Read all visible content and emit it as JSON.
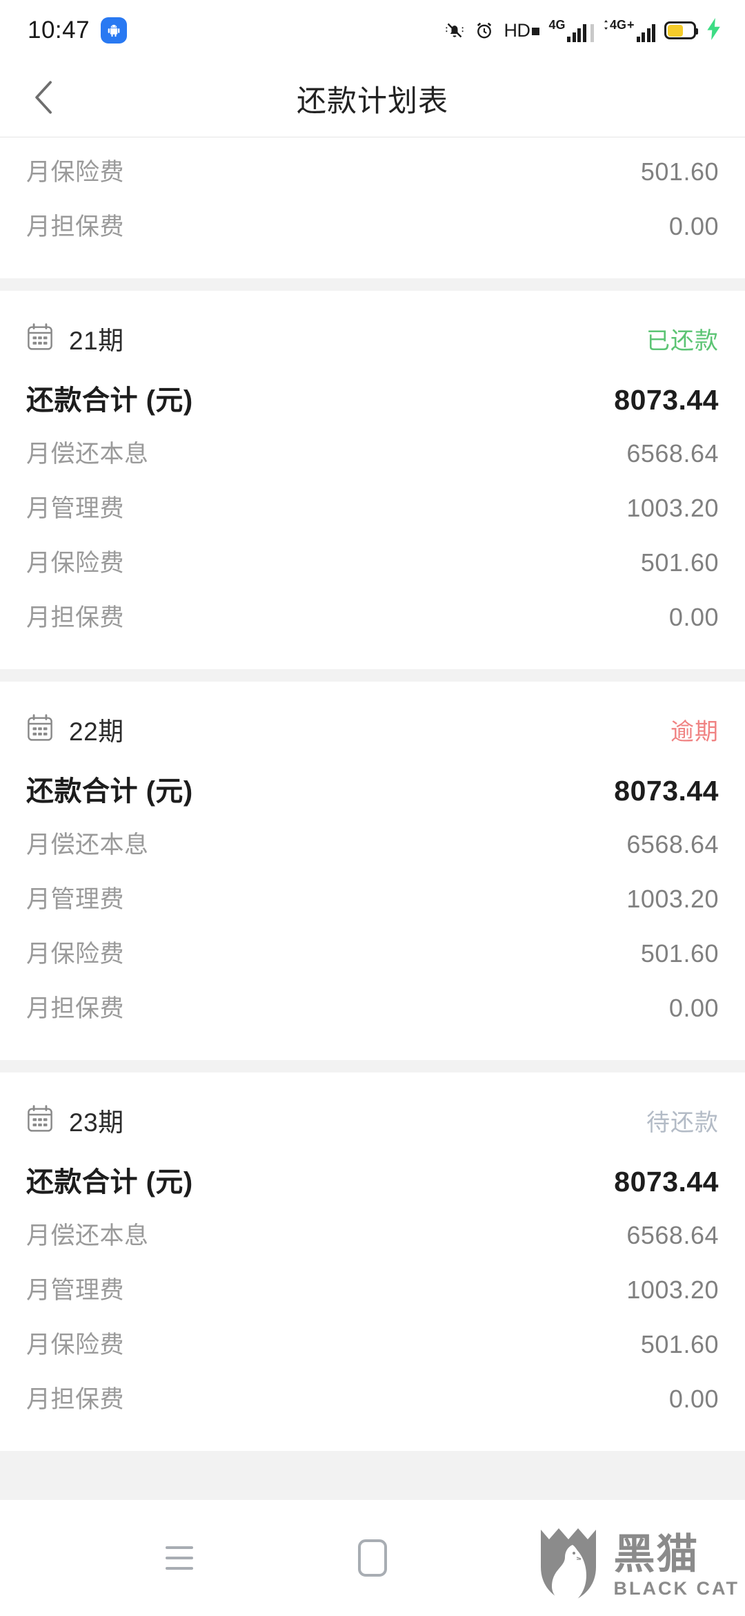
{
  "status_bar": {
    "time": "10:47",
    "app_badge_icon": "android-robot-icon",
    "icons": [
      "mute-vibrate-icon",
      "alarm-clock-icon",
      "hd-voice-icon",
      "signal-4g-icon",
      "signal-4g-plus-icon",
      "battery-charging-icon"
    ],
    "hd_label": "HD",
    "sim1_label": "4G",
    "sim2_label": "4G",
    "colors": {
      "android_badge": "#2979f2",
      "battery_fill": "#f5cc2a",
      "charging_bolt": "#3ddc84"
    }
  },
  "header": {
    "back_icon": "chevron-left-icon",
    "title": "还款计划表"
  },
  "colors": {
    "paid": "#5cc474",
    "overdue": "#f08383",
    "pending": "#b3bbc6",
    "page_bg": "#f2f2f2",
    "card_bg": "#ffffff"
  },
  "labels": {
    "total": "还款合计 (元)",
    "principal_interest": "月偿还本息",
    "management_fee": "月管理费",
    "insurance_fee": "月保险费",
    "guarantee_fee": "月担保费",
    "calendar_icon": "calendar-icon"
  },
  "installments": [
    {
      "partial": true,
      "period": "",
      "status": "",
      "status_type": "",
      "total": "",
      "rows": [
        {
          "label": "月保险费",
          "value": "501.60"
        },
        {
          "label": "月担保费",
          "value": "0.00"
        }
      ]
    },
    {
      "partial": false,
      "period": "21期",
      "status": "已还款",
      "status_type": "paid",
      "total_label": "还款合计 (元)",
      "total": "8073.44",
      "rows": [
        {
          "label": "月偿还本息",
          "value": "6568.64"
        },
        {
          "label": "月管理费",
          "value": "1003.20"
        },
        {
          "label": "月保险费",
          "value": "501.60"
        },
        {
          "label": "月担保费",
          "value": "0.00"
        }
      ]
    },
    {
      "partial": false,
      "period": "22期",
      "status": "逾期",
      "status_type": "overdue",
      "total_label": "还款合计 (元)",
      "total": "8073.44",
      "rows": [
        {
          "label": "月偿还本息",
          "value": "6568.64"
        },
        {
          "label": "月管理费",
          "value": "1003.20"
        },
        {
          "label": "月保险费",
          "value": "501.60"
        },
        {
          "label": "月担保费",
          "value": "0.00"
        }
      ]
    },
    {
      "partial": false,
      "period": "23期",
      "status": "待还款",
      "status_type": "pending",
      "total_label": "还款合计 (元)",
      "total": "8073.44",
      "rows": [
        {
          "label": "月偿还本息",
          "value": "6568.64"
        },
        {
          "label": "月管理费",
          "value": "1003.20"
        },
        {
          "label": "月保险费",
          "value": "501.60"
        },
        {
          "label": "月担保费",
          "value": "0.00"
        }
      ]
    }
  ],
  "bottom_nav": {
    "recents_icon": "menu-recents-icon",
    "home_icon": "home-square-icon",
    "back_icon": "back-triangle-icon"
  },
  "watermark": {
    "logo_icon": "black-cat-shield-logo",
    "name_cn": "黑猫",
    "name_en": "BLACK CAT"
  }
}
